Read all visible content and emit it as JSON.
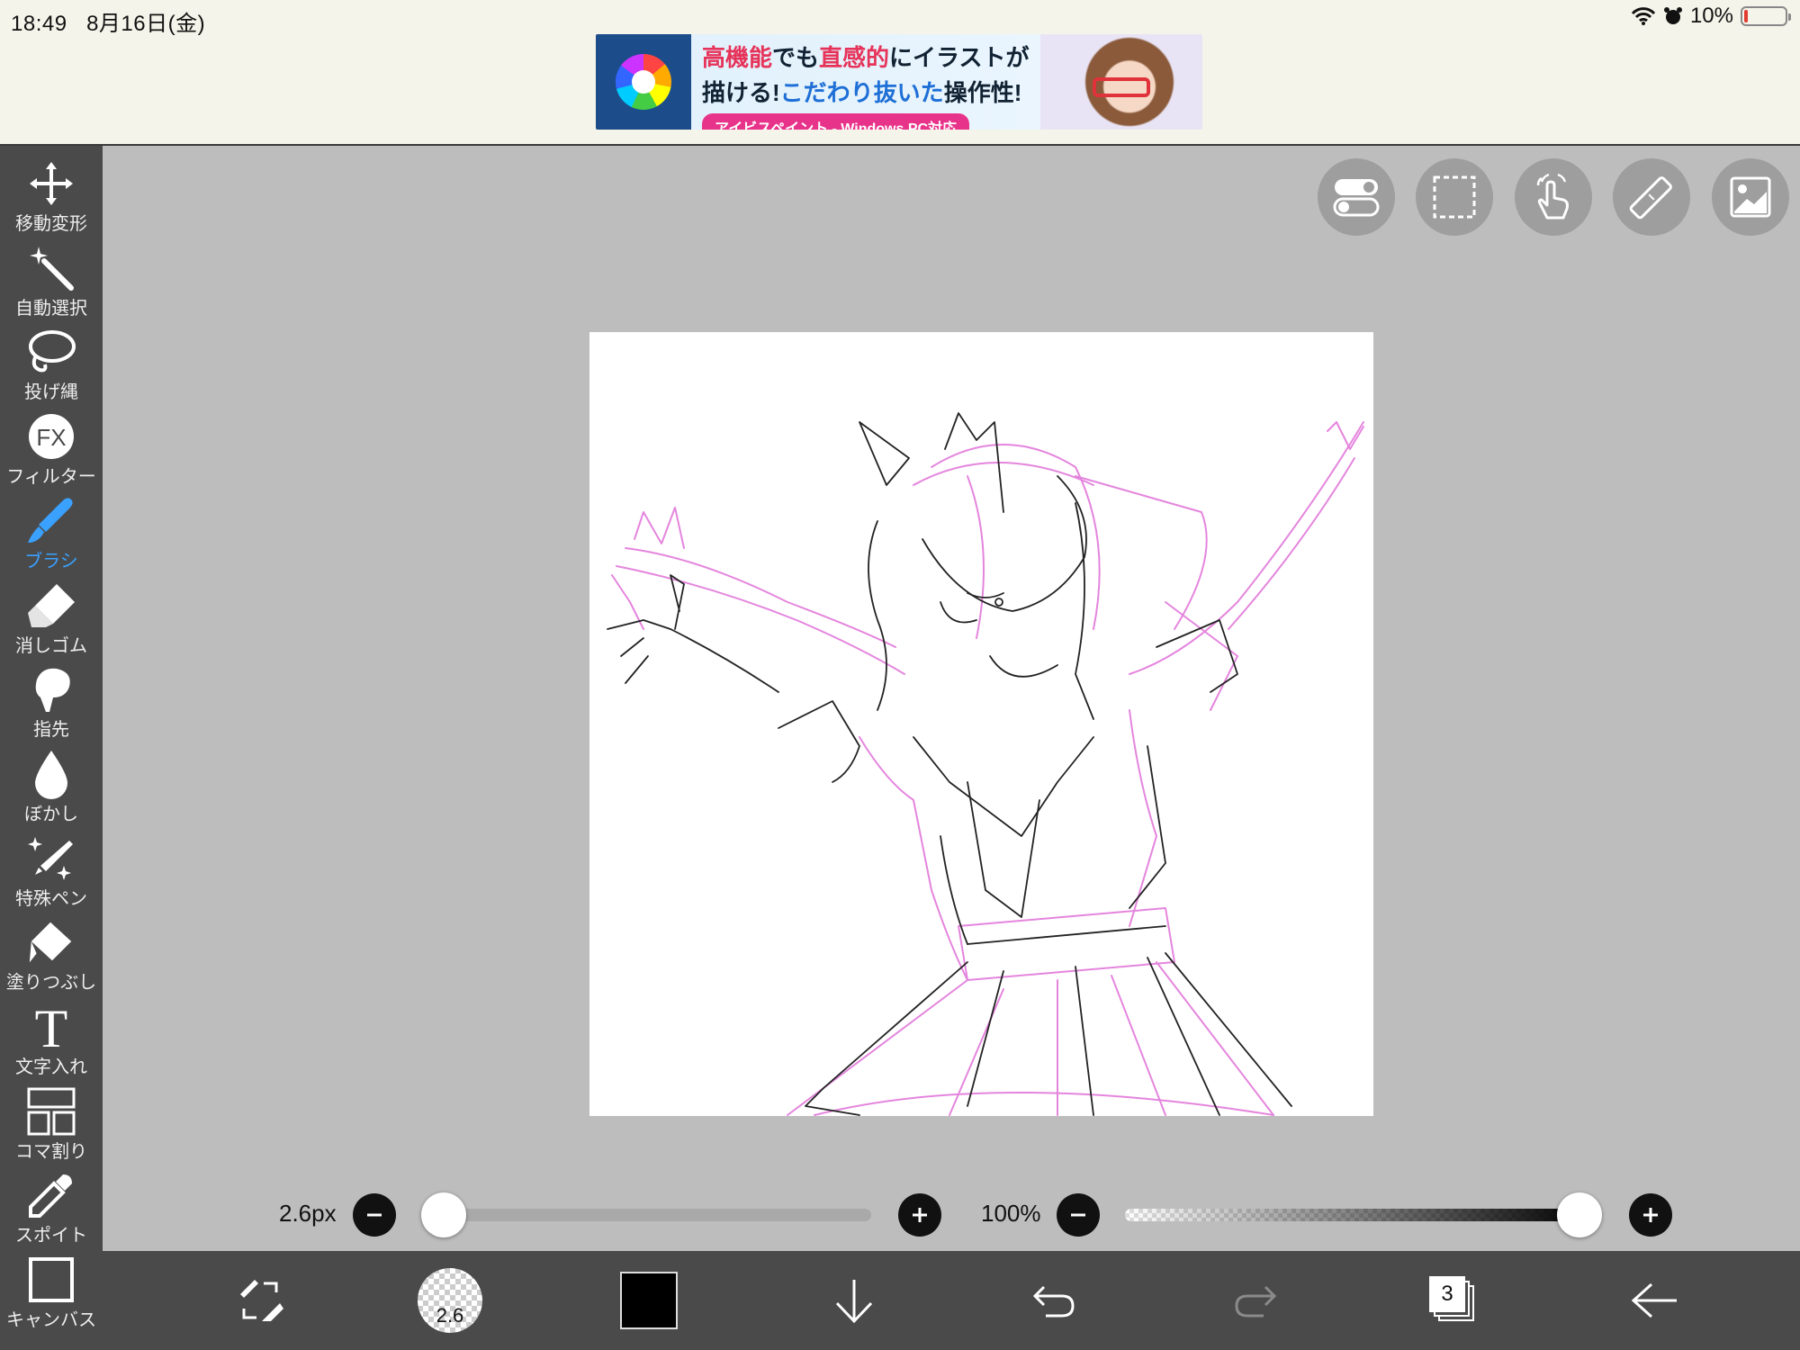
{
  "status_bar": {
    "time": "18:49",
    "date": "8月16日(金)",
    "battery_text": "10%",
    "battery_level": 0.1,
    "icons": [
      "wifi-icon",
      "alarm-icon",
      "battery-icon"
    ]
  },
  "ad": {
    "line1_pre": "高機能",
    "line1_mid": "でも",
    "line1_hl": "直感的",
    "line1_post": "にイラストが",
    "line2_pre": "描ける!",
    "line2_hl": "こだわり抜いた",
    "line2_post": "操作性!",
    "pill": "アイビスペイント - Windows PC対応"
  },
  "tools": [
    {
      "label": "移動変形",
      "icon": "move-icon"
    },
    {
      "label": "自動選択",
      "icon": "magic-wand-icon"
    },
    {
      "label": "投げ縄",
      "icon": "lasso-icon"
    },
    {
      "label": "フィルター",
      "icon": "fx-icon"
    },
    {
      "label": "ブラシ",
      "icon": "brush-icon",
      "active": true
    },
    {
      "label": "消しゴム",
      "icon": "eraser-icon"
    },
    {
      "label": "指先",
      "icon": "smudge-icon"
    },
    {
      "label": "ぼかし",
      "icon": "blur-icon"
    },
    {
      "label": "特殊ペン",
      "icon": "special-pen-icon"
    },
    {
      "label": "塗りつぶし",
      "icon": "fill-icon"
    },
    {
      "label": "文字入れ",
      "icon": "text-icon"
    },
    {
      "label": "コマ割り",
      "icon": "frame-divider-icon"
    },
    {
      "label": "スポイト",
      "icon": "eyedropper-icon"
    },
    {
      "label": "キャンバス",
      "icon": "canvas-icon"
    }
  ],
  "top_buttons": [
    "toggle-icon",
    "selection-icon",
    "gesture-hand-icon",
    "ruler-icon",
    "reference-image-icon"
  ],
  "brush_size": {
    "label": "2.6px",
    "value": 2.6,
    "position": 0.0
  },
  "opacity": {
    "label": "100%",
    "value": 100,
    "position": 1.0
  },
  "bottom_bar": {
    "brush_size_badge": "2.6",
    "current_color": "#000000",
    "layer_count": "3"
  },
  "colors": {
    "sidebar": "#4a4a4a",
    "canvas_bg": "#bdbdbd",
    "active_tool": "#3aa1ff",
    "sketch_pink": "#e070d8",
    "sketch_black": "#222222"
  }
}
